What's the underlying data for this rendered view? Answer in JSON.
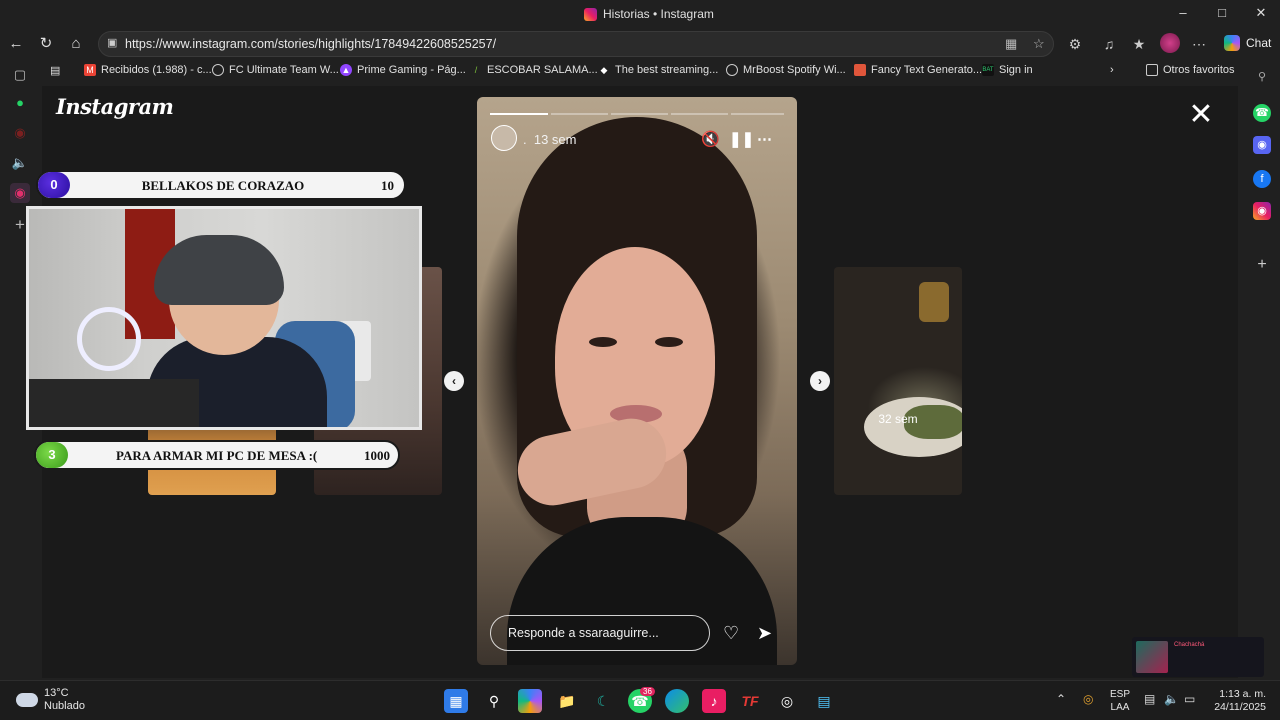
{
  "window": {
    "title": "Historias • Instagram",
    "controls": [
      "minimize",
      "maximize",
      "close"
    ]
  },
  "address_bar": {
    "url": "https://www.instagram.com/stories/highlights/17849422608525257/",
    "chat_label": "Chat"
  },
  "bookmarks": {
    "items": [
      {
        "label": "Recibidos (1.988) - c...",
        "icon": "gmail-icon",
        "color": "#ea4335"
      },
      {
        "label": "FC Ultimate Team W...",
        "icon": "globe-icon",
        "color": "#cccccc"
      },
      {
        "label": "Prime Gaming - Pág...",
        "icon": "prime-gaming-icon",
        "color": "#9146ff"
      },
      {
        "label": "ESCOBAR SALAMA...",
        "icon": "bookmark-icon",
        "color": "#7bbf3a"
      },
      {
        "label": "The best streaming...",
        "icon": "diamond-icon",
        "color": "#ffffff"
      },
      {
        "label": "MrBoost Spotify Wi...",
        "icon": "globe-icon",
        "color": "#cccccc"
      },
      {
        "label": "Fancy Text Generato...",
        "icon": "doc-icon",
        "color": "#e0563b"
      },
      {
        "label": "Sign in",
        "icon": "bat-icon",
        "color": "#2ecc71"
      }
    ],
    "other_folder": "Otros favoritos"
  },
  "instagram": {
    "logo": "Instagram",
    "story": {
      "time": "13 sem",
      "user_dot": ".",
      "reply_placeholder": "Responde a ssaraaguirre...",
      "progress_segments": 5,
      "progress_current_fraction": 0.5
    },
    "next_thumb_time": "32 sem"
  },
  "stream_overlay": {
    "top_bar": {
      "count": "0",
      "label": "BELLAKOS DE CORAZAO",
      "goal": "10"
    },
    "bottom_bar": {
      "count": "3",
      "label": "PARA ARMAR MI PC DE MESA :(",
      "goal": "1000"
    }
  },
  "mini_player": {
    "title": "Chachachá"
  },
  "taskbar": {
    "weather_temp": "13°C",
    "weather_desc": "Nublado",
    "whatsapp_badge": "36",
    "lang_1": "ESP",
    "lang_2": "LAA",
    "time": "1:13 a. m.",
    "date": "24/11/2025"
  },
  "colors": {
    "accent_instagram": "#e1306c",
    "overlay_top_counter": "#3a17c4",
    "overlay_bottom_counter": "#55b82a"
  }
}
